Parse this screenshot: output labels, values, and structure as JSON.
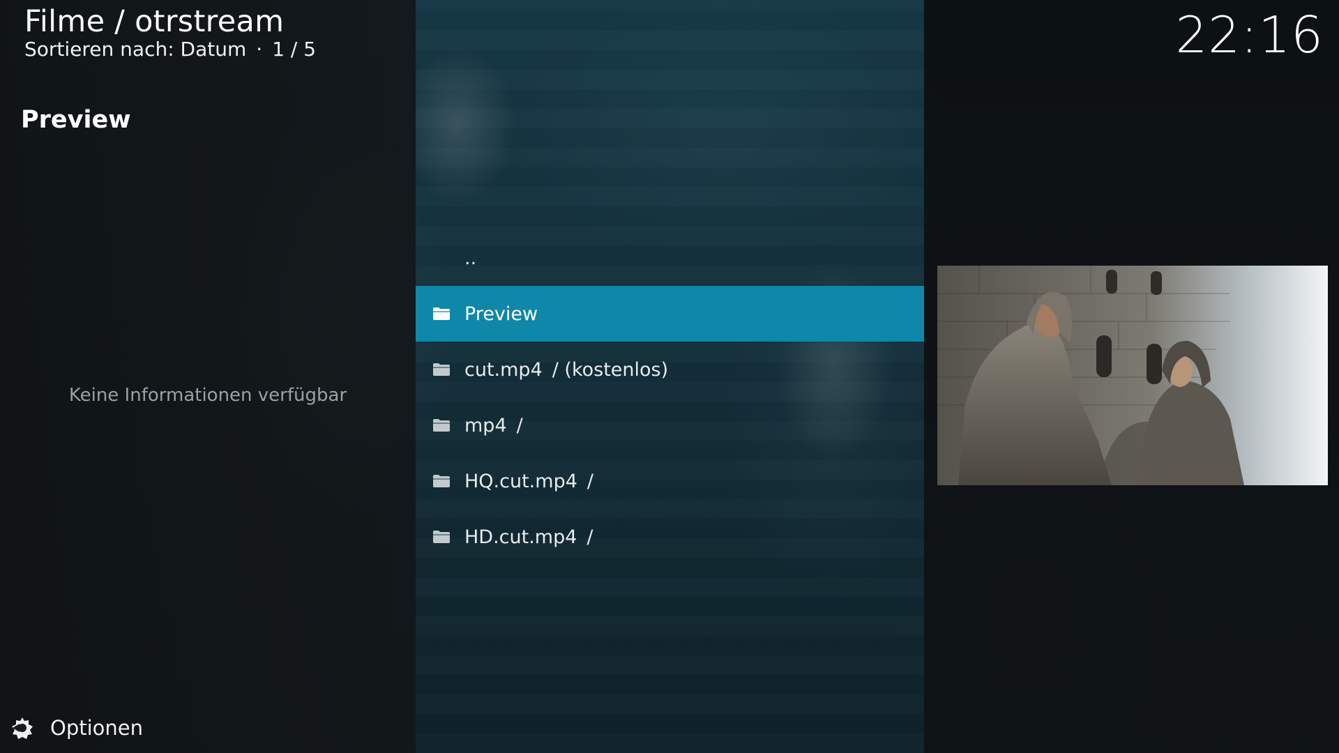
{
  "header": {
    "title": "Filme / otrstream",
    "sort_label": "Sortieren nach: Datum",
    "separator": "·",
    "position": "1 / 5"
  },
  "clock": "22:16",
  "info_panel": {
    "title": "Preview",
    "empty_text": "Keine Informationen verfügbar"
  },
  "list": {
    "items": [
      {
        "label": "..",
        "suffix": "",
        "icon": "none",
        "selected": false
      },
      {
        "label": "Preview",
        "suffix": "",
        "icon": "folder-icon",
        "selected": true
      },
      {
        "label": "cut.mp4",
        "suffix": "/ (kostenlos)",
        "icon": "folder-icon",
        "selected": false
      },
      {
        "label": "mp4",
        "suffix": "/",
        "icon": "folder-icon",
        "selected": false
      },
      {
        "label": "HQ.cut.mp4",
        "suffix": "/",
        "icon": "folder-icon",
        "selected": false
      },
      {
        "label": "HD.cut.mp4",
        "suffix": "/",
        "icon": "folder-icon",
        "selected": false
      }
    ]
  },
  "footer": {
    "options_label": "Optionen",
    "options_icon": "options-icon"
  },
  "colors": {
    "accent": "#0f87a8",
    "text": "#ffffff",
    "muted_text": "#9aa1a5"
  }
}
